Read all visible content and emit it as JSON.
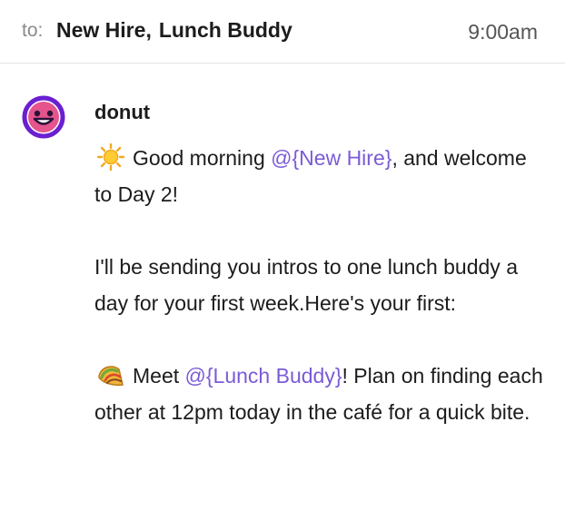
{
  "header": {
    "to_label": "to:",
    "recipient_1": "New Hire",
    "separator": ",",
    "recipient_2": "Lunch Buddy",
    "time": "9:00am"
  },
  "message": {
    "sender": "donut",
    "avatar_icon": "donut-smiley-icon",
    "paragraph_1": {
      "emoji_icon": "sun-icon",
      "text_before": "Good morning ",
      "mention": "@{New Hire}",
      "text_after": ", and welcome to Day 2!"
    },
    "paragraph_2": {
      "text": "I'll be sending you intros to one lunch buddy a day for your first week.Here's your first:"
    },
    "paragraph_3": {
      "emoji_icon": "taco-icon",
      "text_before": "Meet ",
      "mention": "@{Lunch Buddy}",
      "text_after": "! Plan on finding each other at 12pm today in the café for a quick bite."
    }
  },
  "colors": {
    "mention": "#7b5bd6",
    "avatar": "#6a1fd1",
    "text": "#1d1c1d",
    "muted": "#8a8a8a"
  }
}
